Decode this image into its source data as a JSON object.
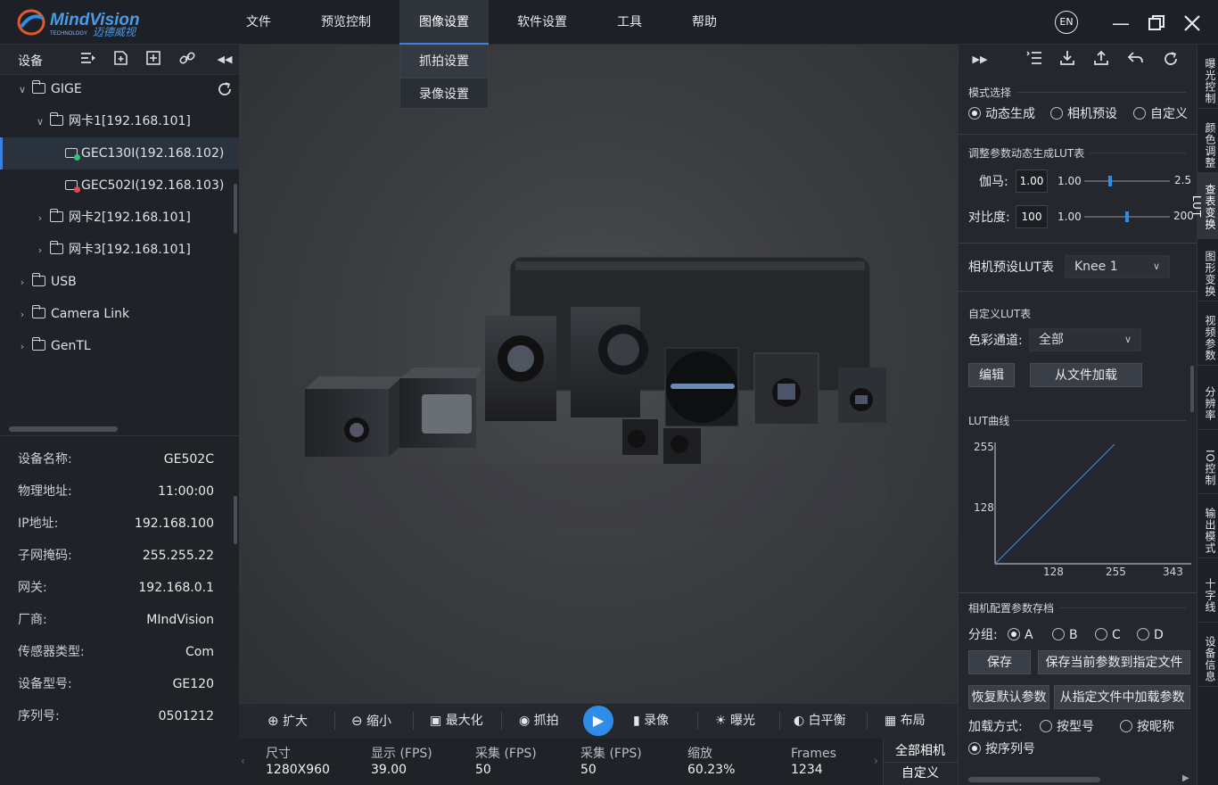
{
  "app": {
    "brand": "MindVision",
    "brand_sub": "TECHNOLOGY",
    "brand_cn": "迈德威视"
  },
  "menu": {
    "items": [
      "文件",
      "预览控制",
      "图像设置",
      "软件设置",
      "工具",
      "帮助"
    ],
    "active": "图像设置"
  },
  "dropdown": {
    "items": [
      "抓拍设置",
      "录像设置"
    ]
  },
  "window": {
    "lang": "EN"
  },
  "left": {
    "title": "设备",
    "tree": {
      "gige": "GIGE",
      "nic1": "网卡1[192.168.101]",
      "cam1": "GEC130I(192.168.102)",
      "cam2": "GEC502I(192.168.103)",
      "nic2": "网卡2[192.168.101]",
      "nic3": "网卡3[192.168.101]",
      "usb": "USB",
      "cameralink": "Camera Link",
      "gentl": "GenTL"
    },
    "info": [
      {
        "k": "设备名称:",
        "v": "GE502C"
      },
      {
        "k": "物理地址:",
        "v": "11:00:00"
      },
      {
        "k": "IP地址:",
        "v": "192.168.100"
      },
      {
        "k": "子网掩码:",
        "v": "255.255.22"
      },
      {
        "k": "网关:",
        "v": "192.168.0.1"
      },
      {
        "k": "厂商:",
        "v": "MIndVision"
      },
      {
        "k": "传感器类型:",
        "v": "Com"
      },
      {
        "k": "设备型号:",
        "v": "GE120"
      },
      {
        "k": "序列号:",
        "v": "0501212"
      }
    ]
  },
  "toolbar": {
    "zoom_in": "扩大",
    "zoom_out": "缩小",
    "maximize": "最大化",
    "snapshot": "抓拍",
    "record": "录像",
    "exposure": "曝光",
    "white_balance": "白平衡",
    "layout": "布局"
  },
  "status": {
    "size_label": "尺寸",
    "size": "1280X960",
    "display_label": "显示 (FPS)",
    "display": "39.00",
    "capture_label": "采集 (FPS)",
    "capture": "50",
    "capture2_label": "采集 (FPS)",
    "capture2": "50",
    "zoom_label": "缩放",
    "zoom": "60.23%",
    "frames_label": "Frames",
    "frames": "1234"
  },
  "camtabs": {
    "all": "全部相机",
    "custom": "自定义"
  },
  "right": {
    "mode_title": "模式选择",
    "mode_options": [
      "动态生成",
      "相机预设",
      "自定义"
    ],
    "mode_selected": 0,
    "dyn_title": "调整参数动态生成LUT表",
    "gamma_label": "伽马:",
    "gamma_value": "1.00",
    "gamma_min": "1.00",
    "gamma_max": "2.5",
    "gamma_level": 0.3,
    "contrast_label": "对比度:",
    "contrast_value": "100",
    "contrast_min": "1.00",
    "contrast_max": "200",
    "contrast_level": 0.5,
    "preset_label": "相机预设LUT表",
    "preset_value": "Knee 1",
    "custom_title": "自定义LUT表",
    "channel_label": "色彩通道:",
    "channel_value": "全部",
    "edit_btn": "编辑",
    "load_file_btn": "从文件加载",
    "curve_title": "LUT曲线",
    "curve_y_ticks": [
      "255",
      "128"
    ],
    "curve_x_ticks": [
      "128",
      "255",
      "343"
    ],
    "save_title": "相机配置参数存档",
    "group_label": "分组:",
    "group_options": [
      "A",
      "B",
      "C",
      "D"
    ],
    "group_selected": 0,
    "save_btn": "保存",
    "save_to_file_btn": "保存当前参数到指定文件",
    "restore_btn": "恢复默认参数",
    "load_from_file_btn": "从指定文件中加载参数",
    "load_mode_label": "加载方式:",
    "load_options": [
      "按型号",
      "按昵称",
      "按序列号"
    ],
    "load_selected": 2
  },
  "vtabs": [
    "曝光控制",
    "颜色调整",
    "查表变换LUT",
    "图形变换",
    "视频参数",
    "分辨率",
    "IO控制",
    "输出模式",
    "十字线",
    "设备信息"
  ],
  "vtab_active": 2
}
